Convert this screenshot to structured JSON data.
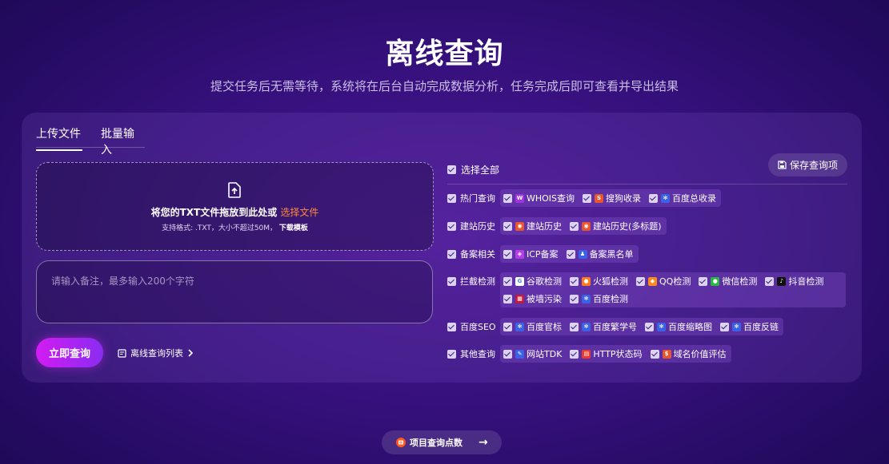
{
  "header": {
    "title": "离线查询",
    "subtitle": "提交任务后无需等待，系统将在后台自动完成数据分析，任务完成后即可查看并导出结果"
  },
  "tabs": [
    {
      "label": "上传文件",
      "active": true
    },
    {
      "label": "批量输入",
      "active": false
    }
  ],
  "upload": {
    "main_text": "将您的TXT文件拖放到此处或",
    "select_link": "选择文件",
    "hint": "支持格式: .TXT，大小不超过50M，",
    "template_link": "下载模板"
  },
  "remark": {
    "placeholder": "请输入备注，最多输入200个字符",
    "value": ""
  },
  "submit_label": "立即查询",
  "offline_list_label": "离线查询列表",
  "select_all_label": "选择全部",
  "save_label": "保存查询项",
  "groups": [
    {
      "label": "热门查询",
      "items": [
        {
          "label": "WHOIS查询",
          "icon": "whois-icon",
          "color": "#a233e0",
          "glyph": "W"
        },
        {
          "label": "搜狗收录",
          "icon": "sogou-icon",
          "color": "#e8552d",
          "glyph": "S"
        },
        {
          "label": "百度总收录",
          "icon": "baidu-icon",
          "color": "#3a62e8",
          "glyph": "✻"
        }
      ]
    },
    {
      "label": "建站历史",
      "items": [
        {
          "label": "建站历史",
          "icon": "history-icon",
          "color": "#e8552d",
          "glyph": "◉"
        },
        {
          "label": "建站历史(多标题)",
          "icon": "history-icon",
          "color": "#e8552d",
          "glyph": "◉"
        }
      ]
    },
    {
      "label": "备案相关",
      "items": [
        {
          "label": "ICP备案",
          "icon": "icp-icon",
          "color": "#b63de8",
          "glyph": "◈"
        },
        {
          "label": "备案黑名单",
          "icon": "blacklist-icon",
          "color": "#3a62e8",
          "glyph": "♟"
        }
      ]
    },
    {
      "label": "拦截检测",
      "items": [
        {
          "label": "谷歌检测",
          "icon": "google-icon",
          "color": "#ffffff",
          "glyph": "G"
        },
        {
          "label": "火狐检测",
          "icon": "firefox-icon",
          "color": "#ff7a1a",
          "glyph": "●"
        },
        {
          "label": "QQ检测",
          "icon": "qq-icon",
          "color": "#ff8a1a",
          "glyph": "◆"
        },
        {
          "label": "微信检测",
          "icon": "wechat-icon",
          "color": "#2bb543",
          "glyph": "●"
        },
        {
          "label": "抖音检测",
          "icon": "douyin-icon",
          "color": "#111111",
          "glyph": "♪"
        },
        {
          "label": "被墙污染",
          "icon": "wall-icon",
          "color": "#c21a3a",
          "glyph": "▦"
        },
        {
          "label": "百度检测",
          "icon": "baidu-icon",
          "color": "#3a62e8",
          "glyph": "✻"
        }
      ]
    },
    {
      "label": "百度SEO",
      "items": [
        {
          "label": "百度官标",
          "icon": "baidu-icon",
          "color": "#3a62e8",
          "glyph": "✻"
        },
        {
          "label": "百度繁学号",
          "icon": "baidu-paw-icon",
          "color": "#3a62e8",
          "glyph": "✻"
        },
        {
          "label": "百度缩略图",
          "icon": "baidu-icon",
          "color": "#3a62e8",
          "glyph": "✻"
        },
        {
          "label": "百度反链",
          "icon": "baidu-icon",
          "color": "#3a62e8",
          "glyph": "✻"
        }
      ]
    },
    {
      "label": "其他查询",
      "items": [
        {
          "label": "网站TDK",
          "icon": "tdk-icon",
          "color": "#3a62e8",
          "glyph": "✎"
        },
        {
          "label": "HTTP状态码",
          "icon": "http-icon",
          "color": "#e83a2d",
          "glyph": "▤"
        },
        {
          "label": "域名价值评估",
          "icon": "value-icon",
          "color": "#e8552d",
          "glyph": "$"
        }
      ]
    }
  ],
  "bottom_button_label": "项目查询点数"
}
